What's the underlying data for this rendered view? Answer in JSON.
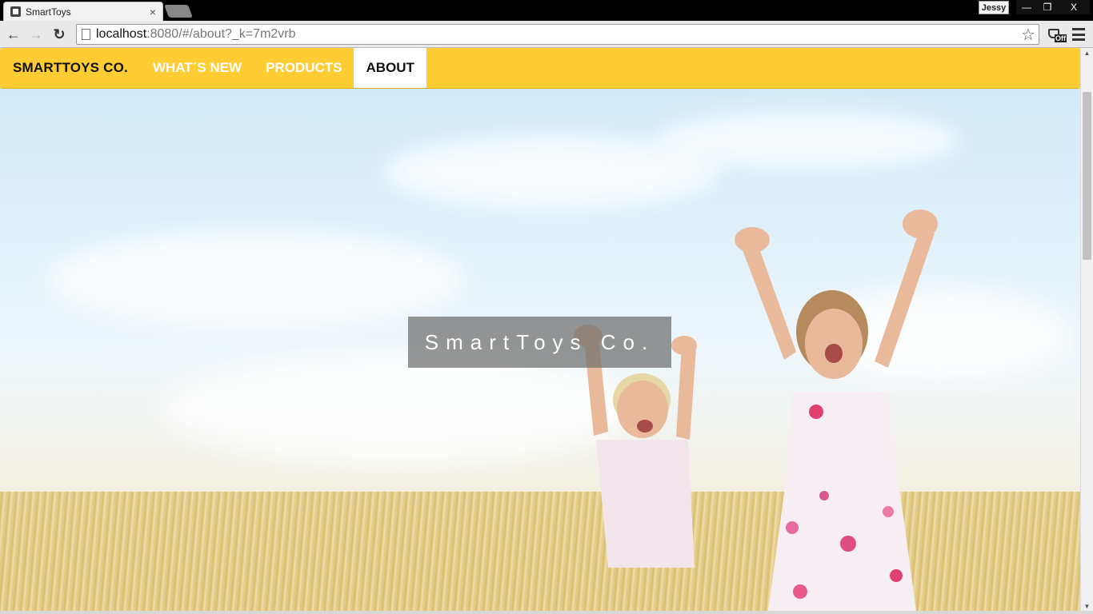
{
  "browser": {
    "tab_title": "SmartToys",
    "tab_close": "×",
    "user_name": "Jessy",
    "url_host": "localhost",
    "url_rest": ":8080/#/about?_k=7m2vrb",
    "star_glyph": "☆",
    "ext_badge": "Off",
    "window_min": "—",
    "window_max": "❐",
    "window_close": "X",
    "back_glyph": "←",
    "forward_glyph": "→",
    "reload_glyph": "↻"
  },
  "navbar": {
    "brand": "SMARTTOYS CO.",
    "links": [
      {
        "label": "WHAT´S NEW",
        "active": false
      },
      {
        "label": "PRODUCTS",
        "active": false
      },
      {
        "label": "ABOUT",
        "active": true
      }
    ],
    "color": "#ffcc33"
  },
  "hero": {
    "title": "SmartToys Co."
  },
  "icons": {
    "favicon": "favicon-icon",
    "page": "page-icon",
    "bookmark": "star-icon",
    "extension": "cup-off-icon",
    "menu": "hamburger-menu-icon"
  }
}
